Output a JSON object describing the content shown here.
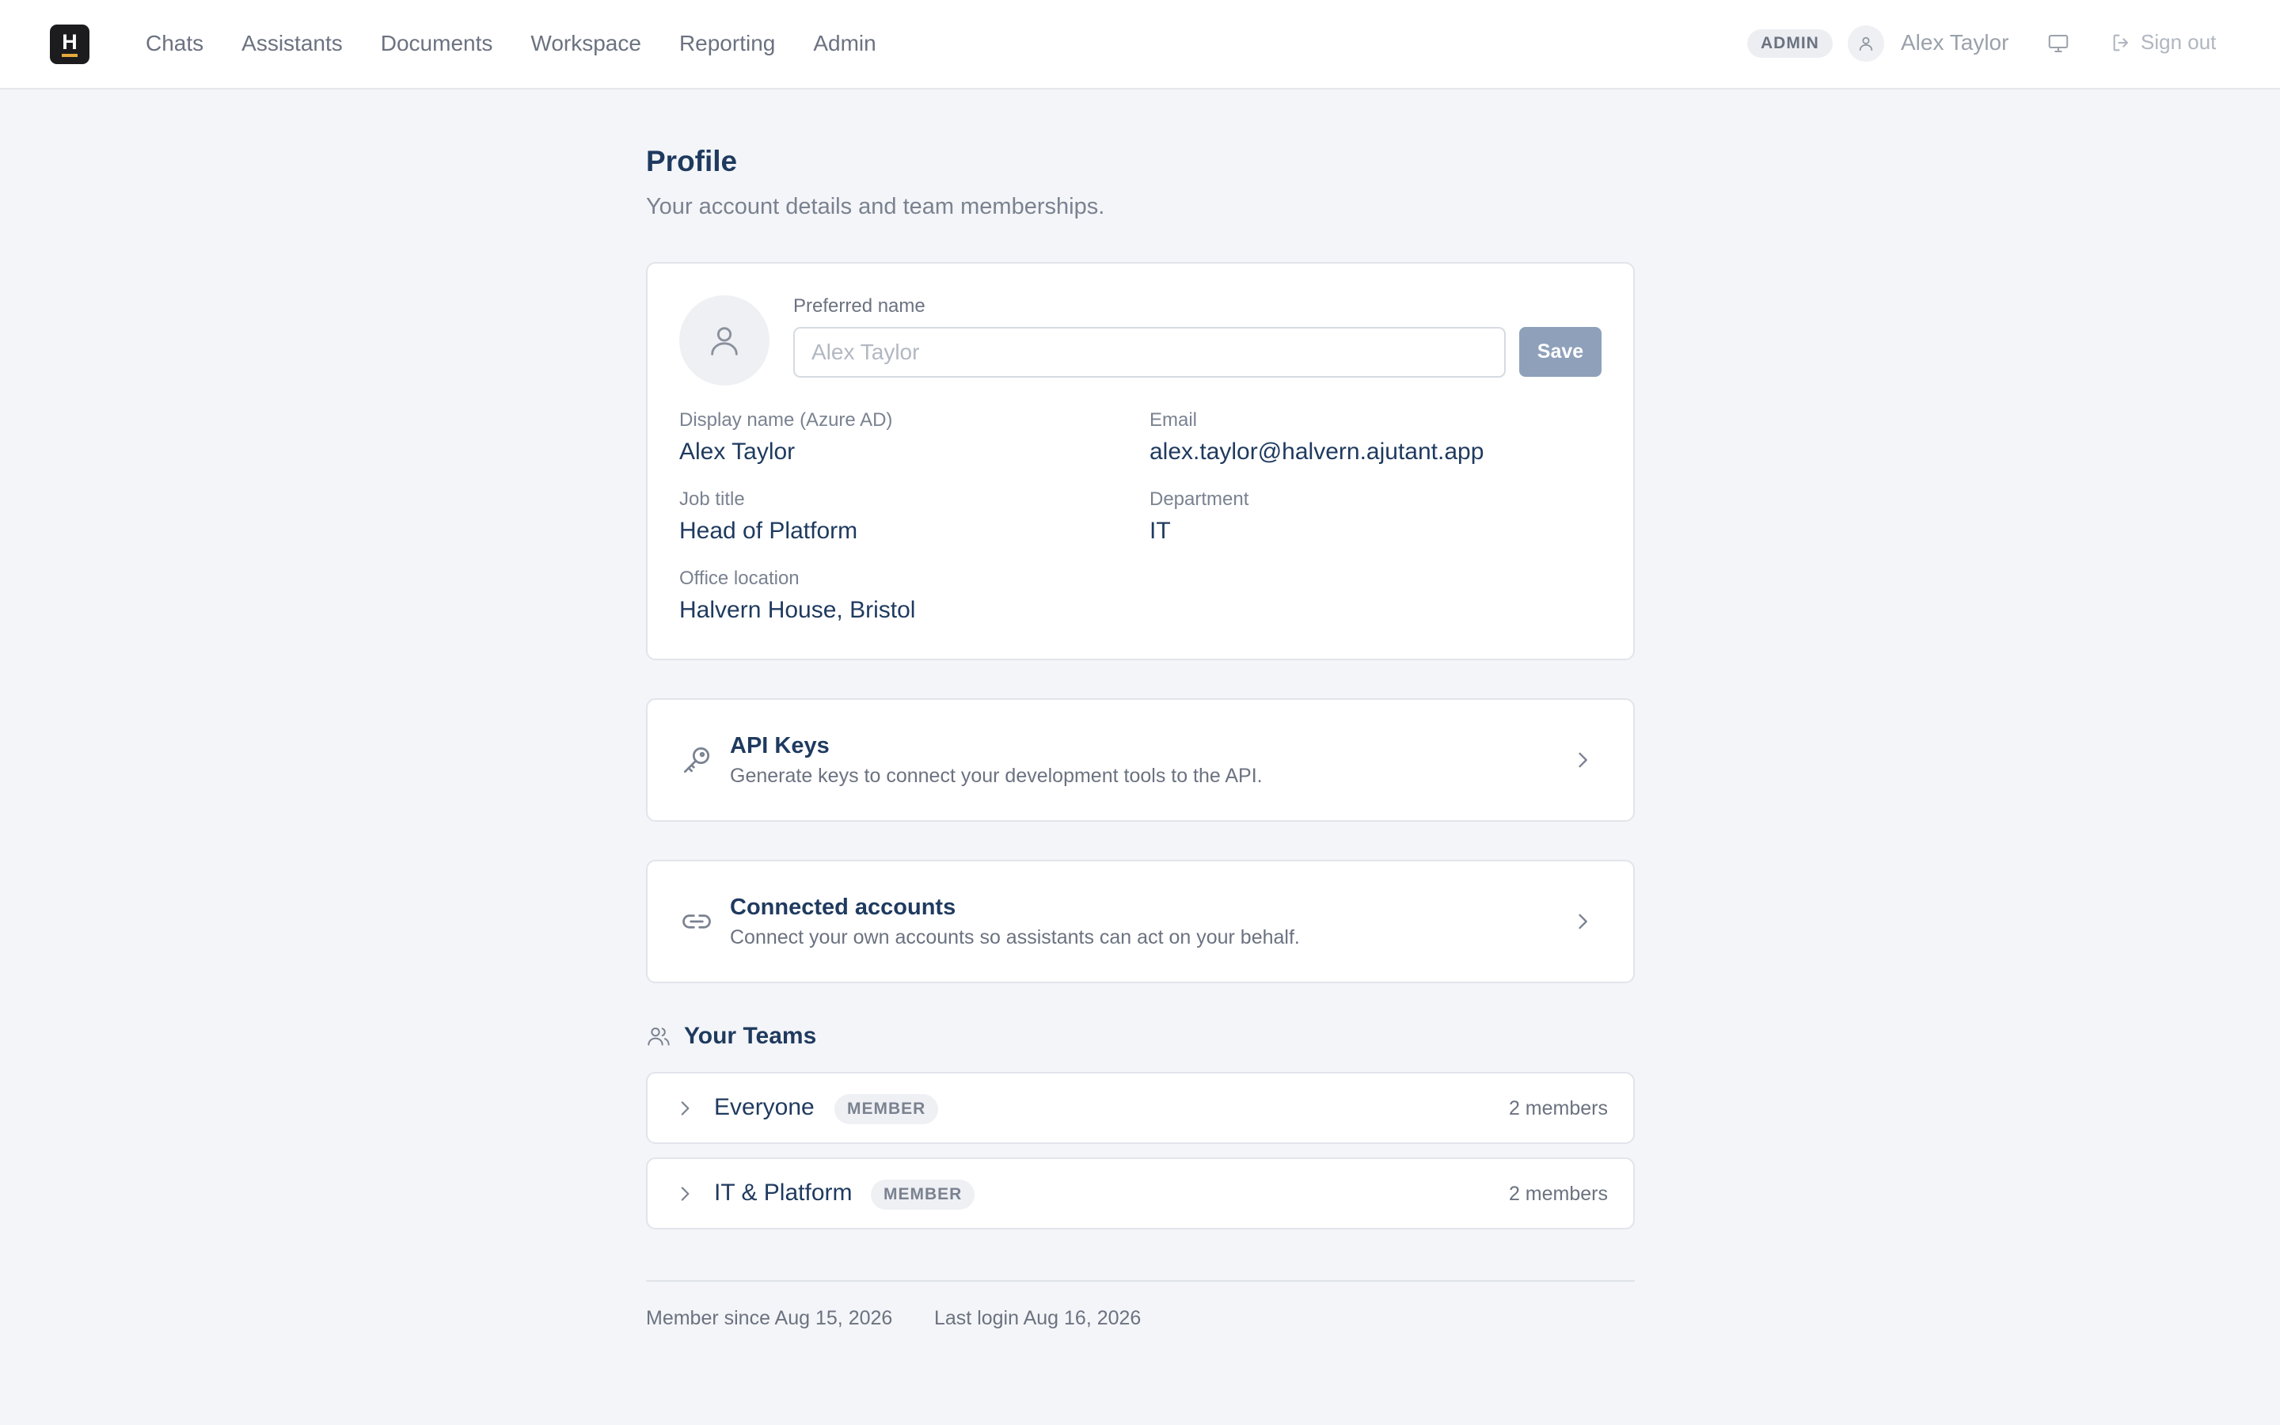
{
  "header": {
    "logo_letter": "H",
    "nav": [
      "Chats",
      "Assistants",
      "Documents",
      "Workspace",
      "Reporting",
      "Admin"
    ],
    "role_badge": "ADMIN",
    "user_name": "Alex Taylor",
    "sign_out": "Sign out"
  },
  "page": {
    "title": "Profile",
    "subtitle": "Your account details and team memberships."
  },
  "profile": {
    "preferred_name_label": "Preferred name",
    "preferred_name_value": "",
    "preferred_name_placeholder": "Alex Taylor",
    "save_label": "Save",
    "fields": {
      "display_name_label": "Display name (Azure AD)",
      "display_name_value": "Alex Taylor",
      "email_label": "Email",
      "email_value": "alex.taylor@halvern.ajutant.app",
      "job_title_label": "Job title",
      "job_title_value": "Head of Platform",
      "department_label": "Department",
      "department_value": "IT",
      "office_label": "Office location",
      "office_value": "Halvern House, Bristol"
    }
  },
  "api_keys": {
    "title": "API Keys",
    "description": "Generate keys to connect your development tools to the API."
  },
  "connected_accounts": {
    "title": "Connected accounts",
    "description": "Connect your own accounts so assistants can act on your behalf."
  },
  "teams": {
    "heading": "Your Teams",
    "items": [
      {
        "name": "Everyone",
        "role": "MEMBER",
        "count": "2 members"
      },
      {
        "name": "IT & Platform",
        "role": "MEMBER",
        "count": "2 members"
      }
    ]
  },
  "footer": {
    "member_since": "Member since Aug 15, 2026",
    "last_login": "Last login Aug 16, 2026"
  },
  "colors": {
    "accent_text": "#1f3a5f",
    "save_button": "#8fa0bb",
    "logo_bg": "#1c1c1e",
    "logo_underline": "#e7a93b",
    "page_bg": "#f4f5f8"
  }
}
